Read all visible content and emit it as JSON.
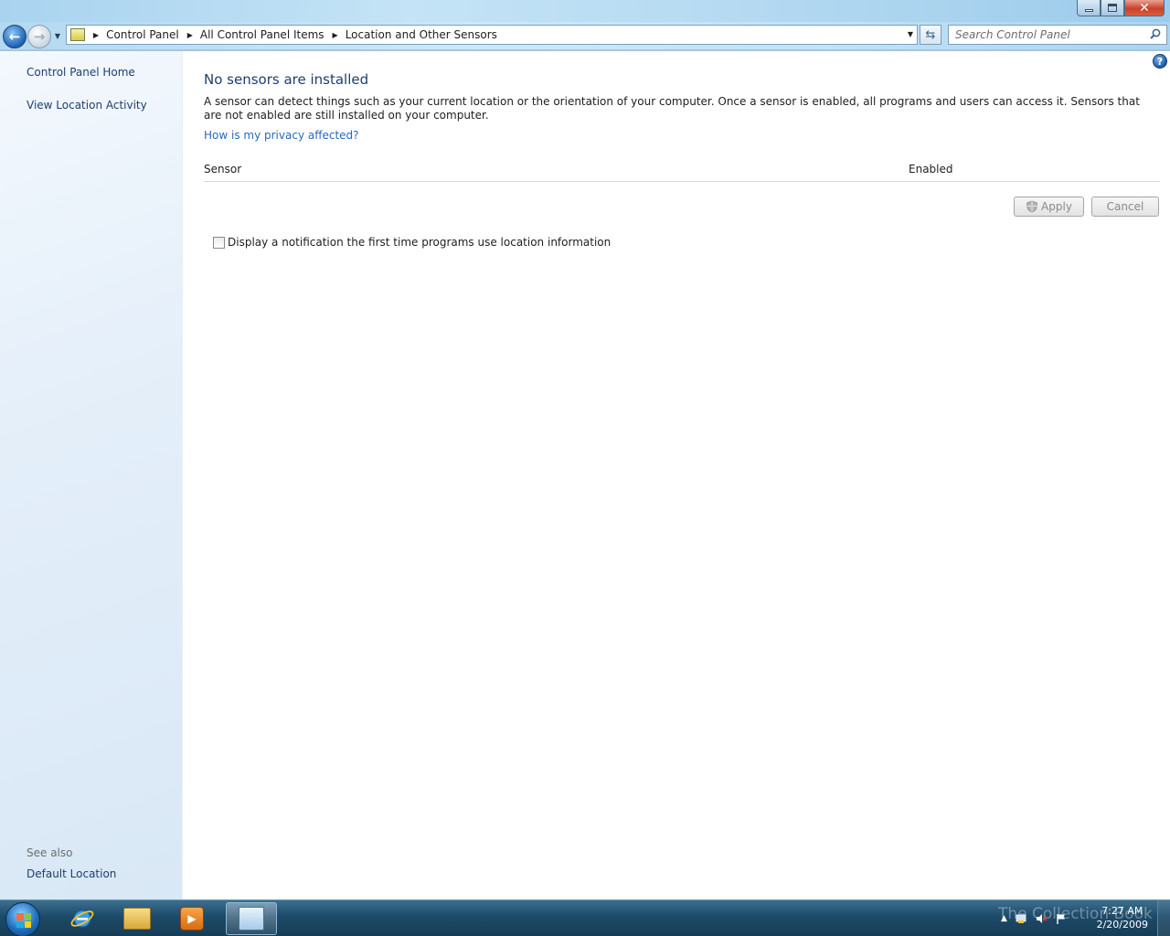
{
  "window": {
    "minimize_label": "",
    "maximize_label": "",
    "close_label": "✕"
  },
  "navigation": {
    "breadcrumbs": [
      "Control Panel",
      "All Control Panel Items",
      "Location and Other Sensors"
    ],
    "search_placeholder": "Search Control Panel"
  },
  "left_pane": {
    "links": [
      "Control Panel Home",
      "View Location Activity"
    ],
    "see_also_label": "See also",
    "see_also_links": [
      "Default Location"
    ]
  },
  "main": {
    "title": "No sensors are installed",
    "description": "A sensor can detect things such as your current location or the orientation of your computer. Once a sensor is enabled, all programs and users can access it. Sensors that are not enabled are still installed on your computer.",
    "privacy_link": "How is my privacy affected?",
    "columns": {
      "sensor": "Sensor",
      "enabled": "Enabled"
    },
    "buttons": {
      "apply": "Apply",
      "cancel": "Cancel"
    },
    "notification_checkbox": {
      "label": "Display a notification the first time programs use location information",
      "checked": false
    }
  },
  "taskbar": {
    "watermark": "The Collection Book",
    "time": "7:27 AM",
    "date": "2/20/2009"
  },
  "colors": {
    "heading": "#1e3f6e",
    "link": "#2c68ba",
    "taskbar": "#1d4a68"
  }
}
